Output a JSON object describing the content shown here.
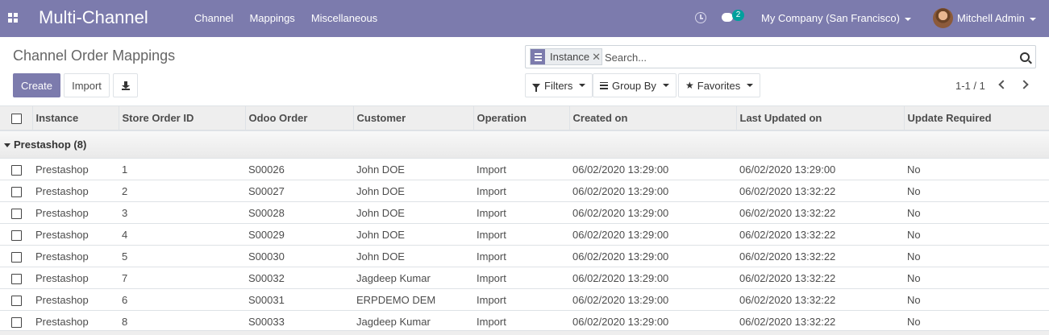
{
  "navbar": {
    "brand": "Multi-Channel",
    "menu": [
      "Channel",
      "Mappings",
      "Miscellaneous"
    ],
    "chat_count": "2",
    "company": "My Company (San Francisco)",
    "user": "Mitchell Admin",
    "color": "#7c7bad"
  },
  "control": {
    "title": "Channel Order Mappings",
    "create_label": "Create",
    "import_label": "Import",
    "facet_value": "Instance",
    "search_placeholder": "Search...",
    "filters_label": "Filters",
    "groupby_label": "Group By",
    "favorites_label": "Favorites",
    "pager": "1-1 / 1"
  },
  "table": {
    "columns": [
      "Instance",
      "Store Order ID",
      "Odoo Order",
      "Customer",
      "Operation",
      "Created on",
      "Last Updated on",
      "Update Required"
    ],
    "group_label": "Prestashop (8)",
    "rows": [
      [
        "Prestashop",
        "1",
        "S00026",
        "John DOE",
        "Import",
        "06/02/2020 13:29:00",
        "06/02/2020 13:29:00",
        "No"
      ],
      [
        "Prestashop",
        "2",
        "S00027",
        "John DOE",
        "Import",
        "06/02/2020 13:29:00",
        "06/02/2020 13:32:22",
        "No"
      ],
      [
        "Prestashop",
        "3",
        "S00028",
        "John DOE",
        "Import",
        "06/02/2020 13:29:00",
        "06/02/2020 13:32:22",
        "No"
      ],
      [
        "Prestashop",
        "4",
        "S00029",
        "John DOE",
        "Import",
        "06/02/2020 13:29:00",
        "06/02/2020 13:32:22",
        "No"
      ],
      [
        "Prestashop",
        "5",
        "S00030",
        "John DOE",
        "Import",
        "06/02/2020 13:29:00",
        "06/02/2020 13:32:22",
        "No"
      ],
      [
        "Prestashop",
        "7",
        "S00032",
        "Jagdeep Kumar",
        "Import",
        "06/02/2020 13:29:00",
        "06/02/2020 13:32:22",
        "No"
      ],
      [
        "Prestashop",
        "6",
        "S00031",
        "ERPDEMO DEM",
        "Import",
        "06/02/2020 13:29:00",
        "06/02/2020 13:32:22",
        "No"
      ],
      [
        "Prestashop",
        "8",
        "S00033",
        "Jagdeep Kumar",
        "Import",
        "06/02/2020 13:29:00",
        "06/02/2020 13:32:22",
        "No"
      ]
    ]
  }
}
